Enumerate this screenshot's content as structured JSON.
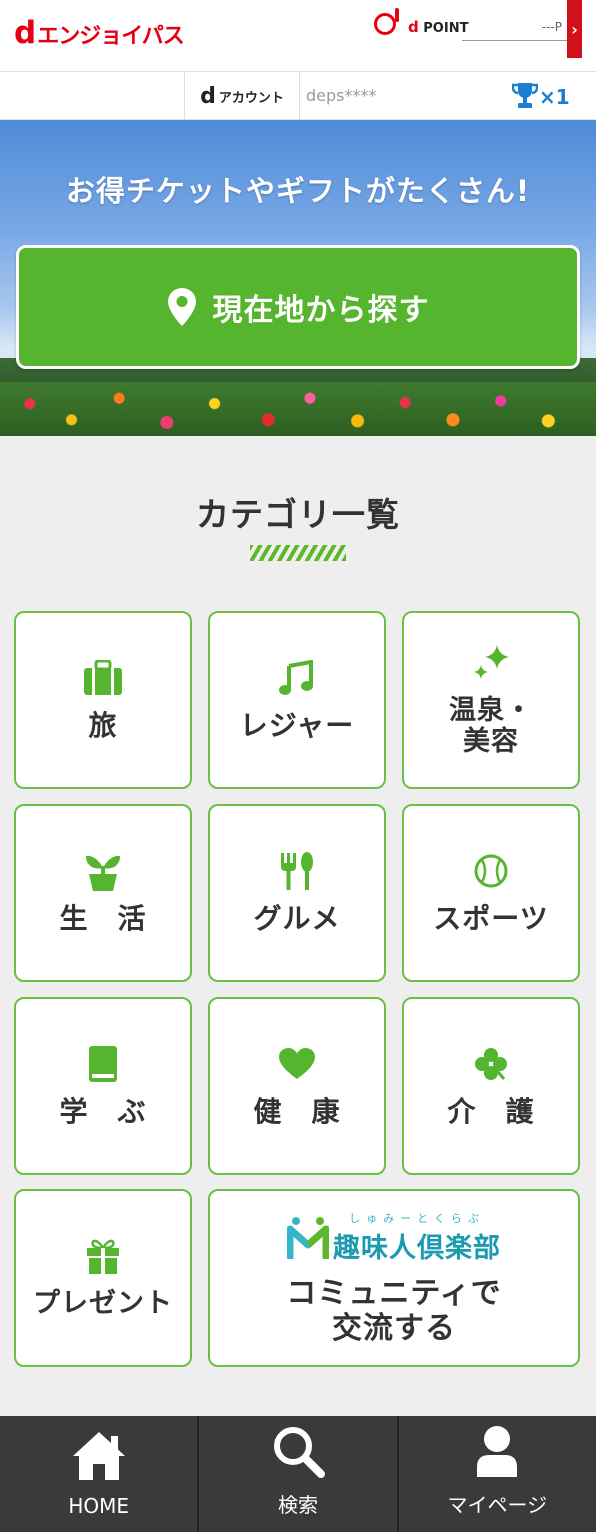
{
  "header": {
    "logo_d": "d",
    "logo_name": "エンジョイパス",
    "dpoint_d": "d",
    "dpoint_label": "POINT",
    "dpoint_value": "---P",
    "dpoint_arrow": "›"
  },
  "account": {
    "d": "d",
    "label": "アカウント",
    "id": "deps****",
    "trophy_count": "×1"
  },
  "hero": {
    "headline": "お得チケットやギフトがたくさん!",
    "locate_button": "現在地から探す"
  },
  "categories": {
    "title": "カテゴリ一覧",
    "items": [
      {
        "label": "旅",
        "icon": "suitcase-icon"
      },
      {
        "label": "レジャー",
        "icon": "music-note-icon"
      },
      {
        "label": "温泉・\n美容",
        "icon": "sparkle-icon"
      },
      {
        "label": "生　活",
        "icon": "sprout-icon"
      },
      {
        "label": "グルメ",
        "icon": "fork-knife-icon"
      },
      {
        "label": "スポーツ",
        "icon": "baseball-icon"
      },
      {
        "label": "学　ぶ",
        "icon": "book-icon"
      },
      {
        "label": "健　康",
        "icon": "heart-icon"
      },
      {
        "label": "介　護",
        "icon": "clover-icon"
      },
      {
        "label": "プレゼント",
        "icon": "gift-icon"
      }
    ],
    "hobby": {
      "ruby": "しゅみーとくらぶ",
      "name": "趣味人倶楽部",
      "label": "コミュニティで\n交流する"
    }
  },
  "nav": {
    "home": "HOME",
    "search": "検索",
    "mypage": "マイページ"
  },
  "colors": {
    "brand_red": "#e60012",
    "accent_green": "#55b52e",
    "nav_bg": "#3a3a3a",
    "hobby_teal": "#1b9ab0"
  }
}
